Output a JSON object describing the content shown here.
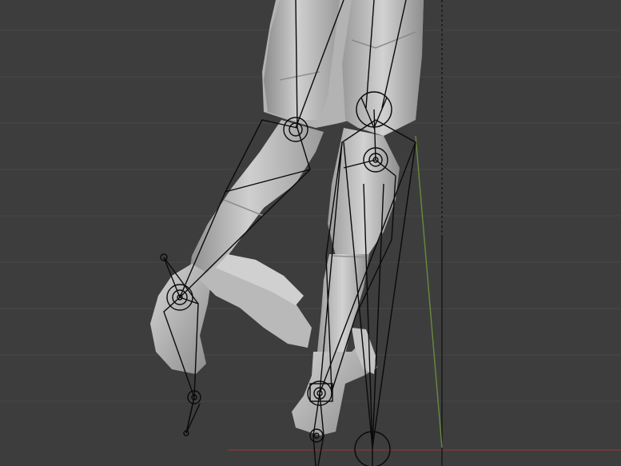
{
  "viewport": {
    "mode": "pose",
    "view": "front",
    "colors": {
      "background": "#3d3d3d",
      "grid_line": "#484848",
      "x_axis": "#7a3a3a",
      "z_axis": "#6a8a3a",
      "mesh_light": "#c9c9c9",
      "mesh_mid": "#a9a9a9",
      "mesh_shadow": "#858585",
      "bone_wire": "#0a0a0a"
    },
    "objects": [
      {
        "name": "character-mesh",
        "type": "mesh"
      },
      {
        "name": "armature",
        "type": "armature"
      },
      {
        "name": "camera-guide",
        "type": "dashed-line"
      }
    ]
  }
}
